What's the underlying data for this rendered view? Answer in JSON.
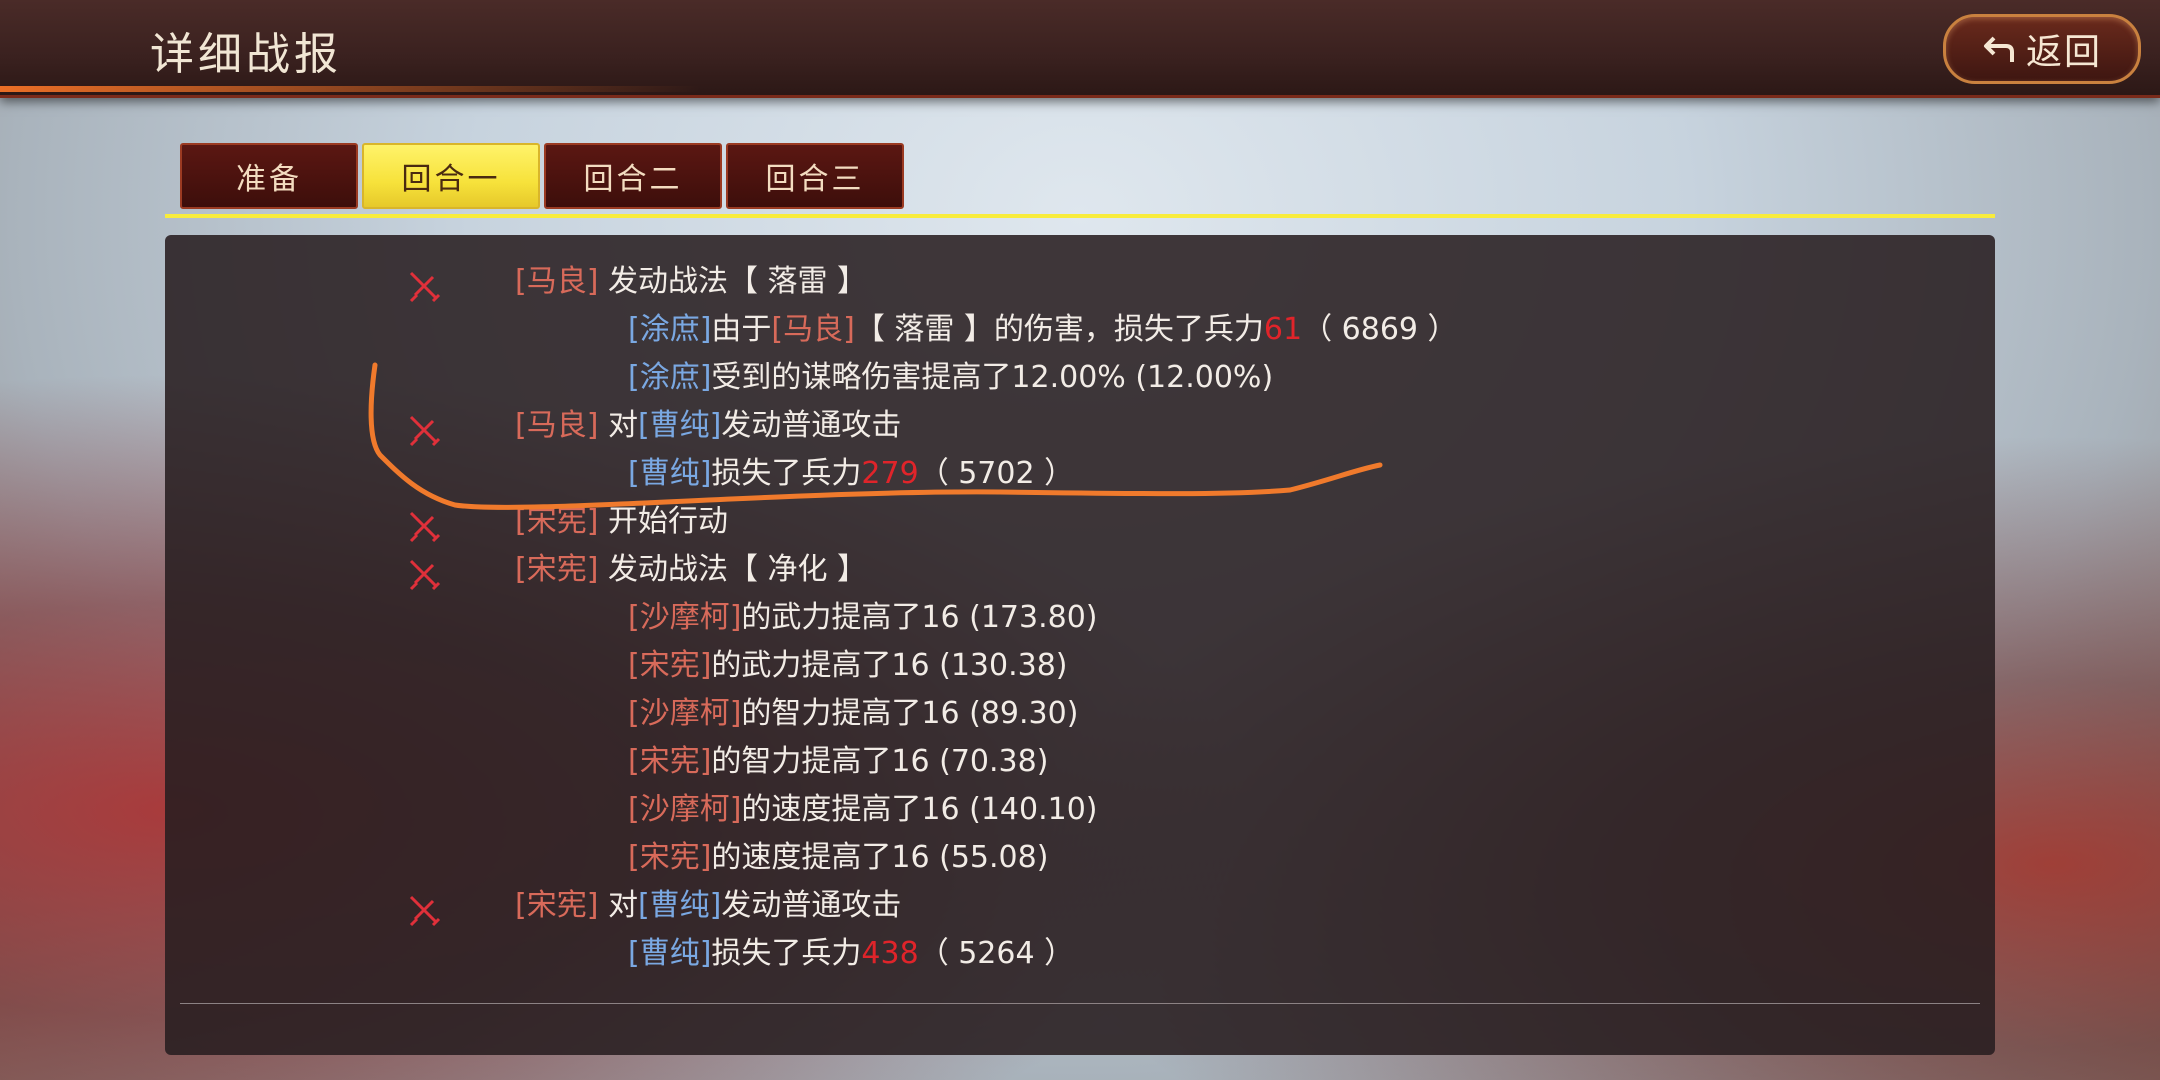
{
  "header": {
    "title": "详细战报",
    "back_label": "返回"
  },
  "tabs": [
    {
      "label": "准备",
      "active": false
    },
    {
      "label": "回合一",
      "active": true
    },
    {
      "label": "回合二",
      "active": false
    },
    {
      "label": "回合三",
      "active": false
    }
  ],
  "colors": {
    "ally_name": "#d86a5a",
    "enemy_name": "#7aa8e2",
    "damage": "#e0242a",
    "active_tab": "#f7e23b",
    "annotation": "#f07a2c"
  },
  "log": [
    {
      "icon": "sword-icon",
      "actor": "[马良]",
      "text": "发动战法【 落雷 】"
    },
    {
      "target": "[涂庶]",
      "text1": "由于",
      "source": "[马良]",
      "text2": "【 落雷 】的伤害，损失了兵力",
      "damage": "61",
      "remain": "（ 6869 ）"
    },
    {
      "target": "[涂庶]",
      "text": "受到的谋略伤害提高了12.00% (12.00%)"
    },
    {
      "icon": "sword-icon",
      "actor": "[马良]",
      "text1": " 对",
      "target": "[曹纯]",
      "text2": "发动普通攻击"
    },
    {
      "target": "[曹纯]",
      "text": "损失了兵力",
      "damage": "279",
      "remain": "（ 5702 ）"
    },
    {
      "icon": "sword-icon",
      "actor": "[宋宪]",
      "text": " 开始行动"
    },
    {
      "icon": "sword-icon",
      "actor": "[宋宪]",
      "text": " 发动战法【 净化 】"
    },
    {
      "target": "[沙摩柯]",
      "text": "的武力提高了16 (173.80)"
    },
    {
      "target": "[宋宪]",
      "text": "的武力提高了16 (130.38)"
    },
    {
      "target": "[沙摩柯]",
      "text": "的智力提高了16 (89.30)"
    },
    {
      "target": "[宋宪]",
      "text": "的智力提高了16 (70.38)"
    },
    {
      "target": "[沙摩柯]",
      "text": "的速度提高了16 (140.10)"
    },
    {
      "target": "[宋宪]",
      "text": "的速度提高了16 (55.08)"
    },
    {
      "icon": "sword-icon",
      "actor": "[宋宪]",
      "text1": " 对",
      "target": "[曹纯]",
      "text2": "发动普通攻击"
    },
    {
      "target": "[曹纯]",
      "text": "损失了兵力",
      "damage": "438",
      "remain": "（ 5264 ）"
    }
  ]
}
